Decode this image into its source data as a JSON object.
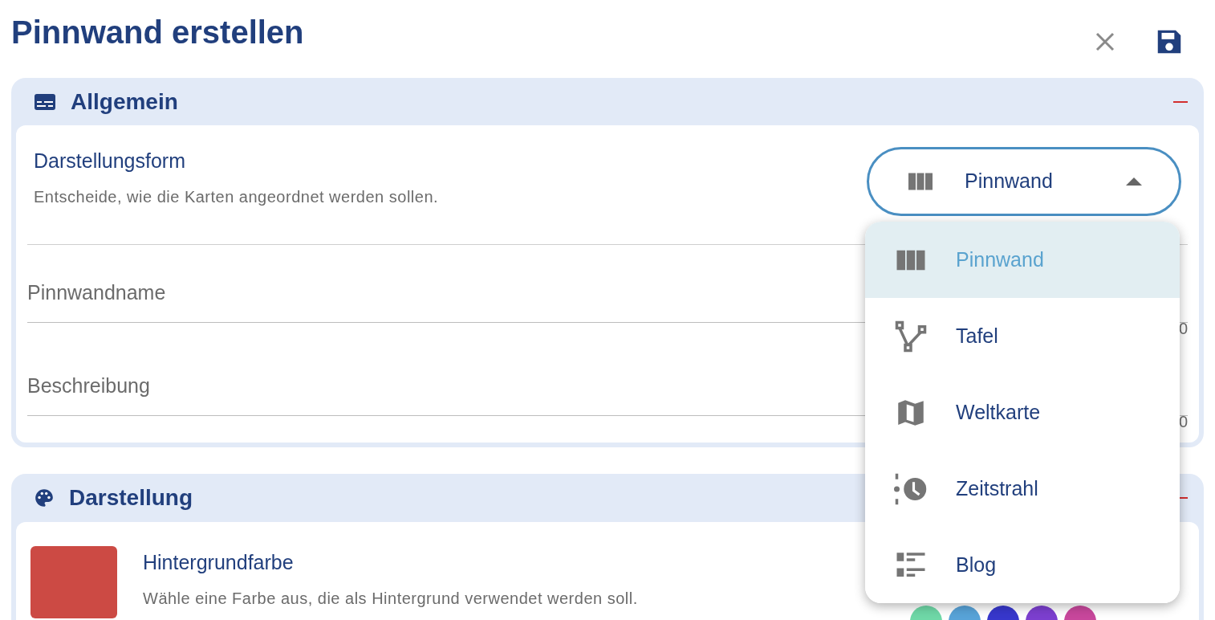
{
  "title": "Pinnwand erstellen",
  "general": {
    "title": "Allgemein",
    "expanded": true,
    "layout_setting": {
      "label": "Darstellungsform",
      "description": "Entscheide, wie die Karten angeordnet werden sollen.",
      "value": "Pinnwand",
      "open": true
    },
    "fields": [
      {
        "placeholder": "Pinnwandname",
        "counter": "0"
      },
      {
        "placeholder": "Beschreibung",
        "counter": "0"
      }
    ]
  },
  "appearance": {
    "title": "Darstellung",
    "expanded": true,
    "background": {
      "label": "Hintergrundfarbe",
      "description": "Wähle eine Farbe aus, die als Hintergrund verwendet werden soll.",
      "color": "#cc4a44",
      "swatches": [
        {
          "color": "#6fd8a7"
        },
        {
          "color": "#58a3d8"
        },
        {
          "color": "#3737cc"
        },
        {
          "color": "#7c3fcf"
        },
        {
          "color": "#c8479c"
        }
      ]
    }
  },
  "menu": [
    {
      "kind": "board",
      "label": "Pinnwand",
      "selected": true
    },
    {
      "kind": "graph",
      "label": "Tafel",
      "selected": false
    },
    {
      "kind": "map",
      "label": "Weltkarte",
      "selected": false
    },
    {
      "kind": "timeline",
      "label": "Zeitstrahl",
      "selected": false
    },
    {
      "kind": "list",
      "label": "Blog",
      "selected": false
    }
  ]
}
